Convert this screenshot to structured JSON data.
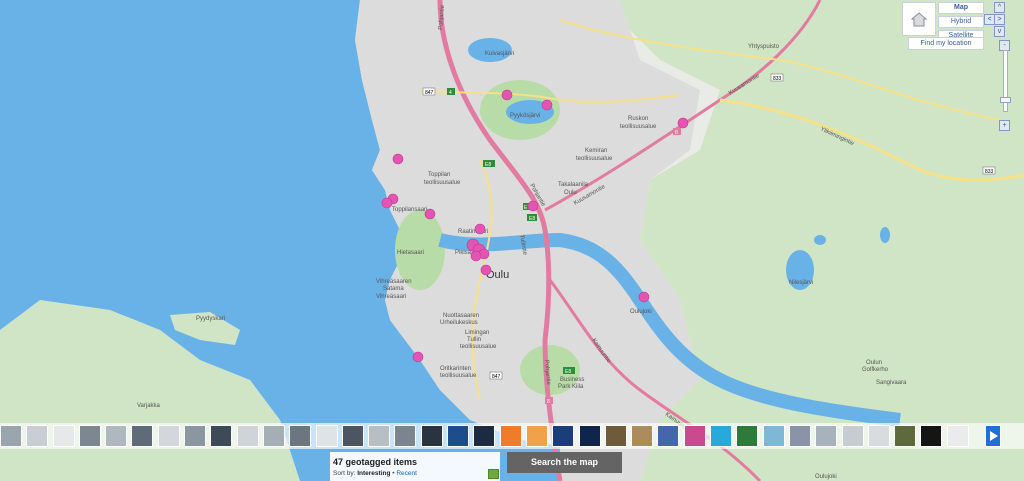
{
  "map": {
    "place_labels": {
      "oulu": "Oulu",
      "kuivasjarvi": "Kuivasjärvi",
      "pyykosjarvi": "Pyykösjärvi",
      "ruskon": "Ruskon",
      "ruskon_area": "teollisuusalue",
      "kemiran": "Kemiran",
      "kemiran_area": "teollisuusalue",
      "toppilan": "Toppilan",
      "toppilan_area": "teollisuusalue",
      "toppilansaari": "Toppilansaari",
      "takalaanila": "Takalaanila",
      "takalaanila_sub": "Oulu",
      "raatinsaari": "Raatinsaari",
      "hietasaari": "Hietasaari",
      "pikisaari": "Pikisaari",
      "vihreasaari_1": "Vihreäsaaren",
      "vihreasaari_2": "Satama",
      "vihreasaari_3": "Vihreäsaari",
      "nuottasaari_1": "Nuottasaaren",
      "nuottasaari_2": "Urheilukeskus",
      "limingan_1": "Limingan",
      "limingan_2": "Tullin",
      "limingan_3": "teollisuusalue",
      "oritkari_1": "Oritkarinten",
      "oritkari_2": "teollisuusalue",
      "business_1": "Business",
      "business_2": "Park Kiila",
      "yhtyspuisto": "Yhtyspuisto",
      "nilesjarvi": "Nilesjärvi",
      "pyydyskari": "Pyydyskari",
      "varjakka": "Varjakka",
      "oulun_golf_1": "Oulun",
      "oulun_golf_2": "Golfkerho",
      "sangivaara": "Sangivaara",
      "oulujoki": "Oulujoki",
      "oulujoki_2": "Oulujoki",
      "kuusamontie": "Kuusamontie",
      "kuusamontie_2": "Kuusamontie",
      "kainuuntie": "Kainuuntie",
      "kainuuntie_2": "Kainuuntie",
      "pohjantie": "Pohjantie",
      "pohjantie_2": "Pohjantie",
      "pohjantie_3": "Pohjantie",
      "ylikiimingintie": "Ylikiimingintie",
      "tullintie": "Tullintie"
    },
    "road_shields": [
      "847",
      "4",
      "E8",
      "E75",
      "E8",
      "833",
      "847",
      "8",
      "E8",
      "8",
      "833"
    ]
  },
  "controls": {
    "map_types": [
      "Map",
      "Hybrid",
      "Satellite"
    ],
    "active_map_type": "Map",
    "find_location": "Find my location",
    "pan_up": "^",
    "pan_left": "<",
    "pan_right": ">",
    "pan_down": "v",
    "zoom_in": "+",
    "zoom_out": "-"
  },
  "filmstrip": {
    "thumbnail_count": 37
  },
  "results": {
    "count_text": "47 geotagged items",
    "sort_label": "Sort by:",
    "sort_current": "Interesting",
    "sort_separator": "•",
    "sort_other": "Recent"
  },
  "search_button": "Search the map",
  "colors": {
    "water": "#69b2e8",
    "land": "#e9ece6",
    "forest": "#cfe5c5",
    "park": "#b8dca7",
    "urban": "#dcdcdc",
    "highway": "#e37ba0",
    "road_main": "#f6e189",
    "marker": "#e455b3",
    "button_dark": "#646464",
    "accent_blue": "#1f6fd6"
  }
}
